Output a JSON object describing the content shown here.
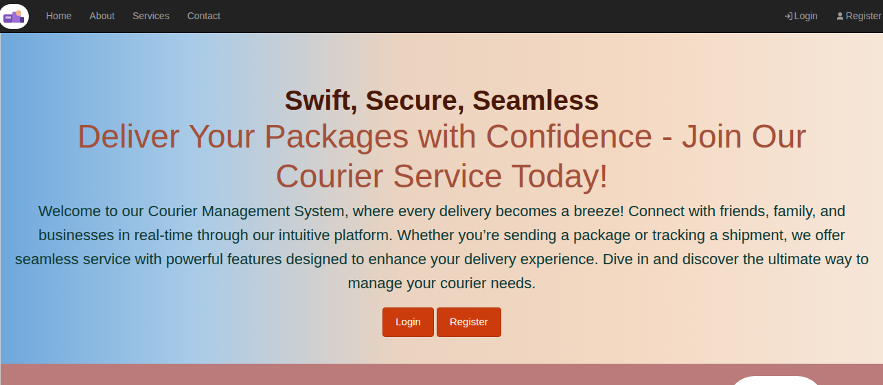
{
  "nav": {
    "links": [
      {
        "label": "Home"
      },
      {
        "label": "About"
      },
      {
        "label": "Services"
      },
      {
        "label": "Contact"
      }
    ],
    "auth": [
      {
        "label": "Login",
        "kind": "login"
      },
      {
        "label": "Register",
        "kind": "register"
      }
    ]
  },
  "hero": {
    "title": "Swift, Secure, Seamless",
    "headline": "Deliver Your Packages with Confidence - Join Our Courier Service Today!",
    "body": "Welcome to our Courier Management System, where every delivery becomes a breeze! Connect with friends, family, and businesses in real-time through our intuitive platform. Whether you’re sending a package or tracking a shipment, we offer seamless service with powerful features designed to enhance your delivery experience. Dive in and discover the ultimate way to manage your courier needs.",
    "buttons": [
      "Login",
      "Register"
    ]
  }
}
